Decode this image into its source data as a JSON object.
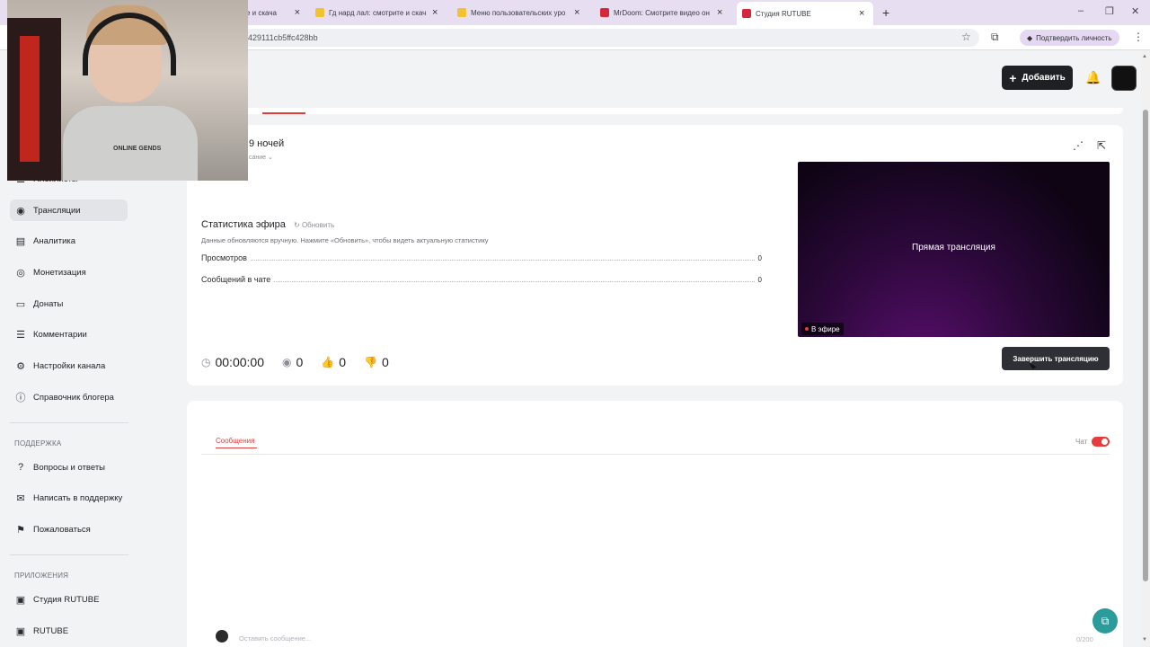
{
  "browser": {
    "tabs": [
      {
        "title": "е и скача",
        "favicon_color": "#f2c230"
      },
      {
        "title": "Гд нард лал: смотрите и скач",
        "favicon_color": "#f2c230"
      },
      {
        "title": "Меню пользовательских уро",
        "favicon_color": "#f2c230"
      },
      {
        "title": "MrDoom: Смотрите видео он",
        "favicon_color": "#d6263a"
      },
      {
        "title": "Студия RUTUBE",
        "favicon_color": "#d6263a"
      }
    ],
    "url": "429111cb5ffc428bb",
    "verify_label": "Подтвердить личность"
  },
  "header": {
    "add_label": "Добавить"
  },
  "webcam": {
    "shirt_text": "ONLINE GENDS"
  },
  "sidebar": {
    "partial_item": "Плейлисты",
    "items": [
      {
        "label": "Трансляции",
        "icon": "broadcast-icon",
        "active": true
      },
      {
        "label": "Аналитика",
        "icon": "chart-icon"
      },
      {
        "label": "Монетизация",
        "icon": "money-icon"
      },
      {
        "label": "Донаты",
        "icon": "donate-icon"
      },
      {
        "label": "Комментарии",
        "icon": "comment-icon"
      },
      {
        "label": "Настройки канала",
        "icon": "gear-icon"
      },
      {
        "label": "Справочник блогера",
        "icon": "info-icon"
      }
    ],
    "support_title": "ПОДДЕРЖКА",
    "support_items": [
      {
        "label": "Вопросы и ответы",
        "icon": "help-icon"
      },
      {
        "label": "Написать в поддержку",
        "icon": "mail-icon"
      },
      {
        "label": "Пожаловаться",
        "icon": "flag-icon"
      }
    ],
    "apps_title": "ПРИЛОЖЕНИЯ",
    "apps_items": [
      {
        "label": "Студия RUTUBE",
        "icon": "studio-icon"
      },
      {
        "label": "RUTUBE",
        "icon": "rutube-icon"
      }
    ]
  },
  "stream": {
    "title": "9 ночей",
    "subtitle": "сание",
    "stats_title": "Статистика эфира",
    "refresh_label": "Обновить",
    "stats_note": "Данные обновляются вручную. Нажмите «Обновить», чтобы видеть актуальную статистику",
    "stats_rows": [
      {
        "label": "Просмотров",
        "value": "0"
      },
      {
        "label": "Сообщений в чате",
        "value": "0"
      }
    ],
    "timer": "00:00:00",
    "viewers": "0",
    "likes": "0",
    "dislikes": "0",
    "player_title": "Прямая трансляция",
    "live_badge": "В эфире",
    "end_button": "Завершить трансляцию"
  },
  "chat": {
    "tab_label": "Сообщения",
    "toggle_label": "Чат",
    "toggle_on": true,
    "input_placeholder": "Оставить сообщение...",
    "char_count": "0/200"
  }
}
